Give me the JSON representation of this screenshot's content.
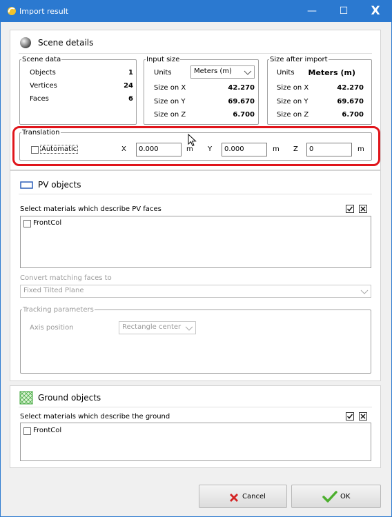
{
  "window": {
    "title": "Import result",
    "minimize_glyph": "—",
    "maximize_glyph": "☐",
    "close_glyph": "X"
  },
  "scene": {
    "title": "Scene details",
    "scene_data": {
      "legend": "Scene data",
      "rows": [
        {
          "label": "Objects",
          "value": "1"
        },
        {
          "label": "Vertices",
          "value": "24"
        },
        {
          "label": "Faces",
          "value": "6"
        }
      ]
    },
    "input_size": {
      "legend": "Input size",
      "units_label": "Units",
      "units_value": "Meters (m)",
      "rows": [
        {
          "label": "Size on X",
          "value": "42.270"
        },
        {
          "label": "Size on Y",
          "value": "69.670"
        },
        {
          "label": "Size on Z",
          "value": "6.700"
        }
      ]
    },
    "size_after": {
      "legend": "Size after import",
      "units_label": "Units",
      "units_value": "Meters (m)",
      "rows": [
        {
          "label": "Size on X",
          "value": "42.270"
        },
        {
          "label": "Size on Y",
          "value": "69.670"
        },
        {
          "label": "Size on Z",
          "value": "6.700"
        }
      ]
    },
    "translation": {
      "legend": "Translation",
      "automatic_label": "Automatic",
      "x_label": "X",
      "x_value": "0.000",
      "x_unit": "m",
      "y_label": "Y",
      "y_value": "0.000",
      "y_unit": "m",
      "z_label": "Z",
      "z_value": "0",
      "z_unit": "m"
    }
  },
  "pv": {
    "title": "PV objects",
    "select_label": "Select materials which describe PV faces",
    "materials": [
      {
        "label": "FrontCol"
      }
    ],
    "convert_label": "Convert matching faces to",
    "convert_value": "Fixed Tilted Plane",
    "tracking": {
      "legend": "Tracking parameters",
      "axis_label": "Axis position",
      "axis_value": "Rectangle center"
    }
  },
  "ground": {
    "title": "Ground objects",
    "select_label": "Select materials which describe the ground",
    "materials": [
      {
        "label": "FrontCol"
      }
    ]
  },
  "buttons": {
    "cancel": "Cancel",
    "ok": "OK"
  },
  "colors": {
    "titlebar": "#2b79d0",
    "highlight": "#e0151b",
    "pv_icon": "#2b5fb8",
    "ground_icon": "#3da53a",
    "ok_check": "#4caf2e",
    "cancel_x": "#d42424"
  }
}
